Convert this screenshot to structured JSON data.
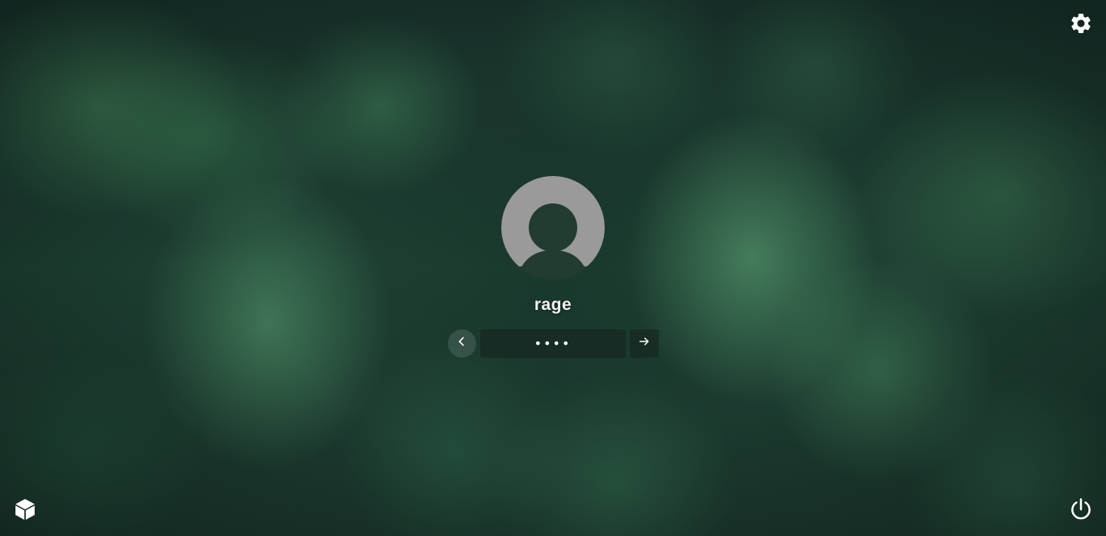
{
  "background": {
    "description_colors": [
      "#1e3a2e",
      "#4d9664",
      "#18302a"
    ]
  },
  "top_bar": {
    "settings_icon": "gear-icon"
  },
  "user": {
    "avatar_icon": "user-avatar-placeholder",
    "name": "rage"
  },
  "login": {
    "back_icon": "chevron-left-icon",
    "password_value": "••••",
    "submit_icon": "arrow-right-icon"
  },
  "bottom_bar": {
    "session_icon": "cube-icon",
    "power_icon": "power-icon"
  },
  "colors": {
    "icon_white": "#ffffff",
    "avatar_gray": "#9a9a9a"
  }
}
